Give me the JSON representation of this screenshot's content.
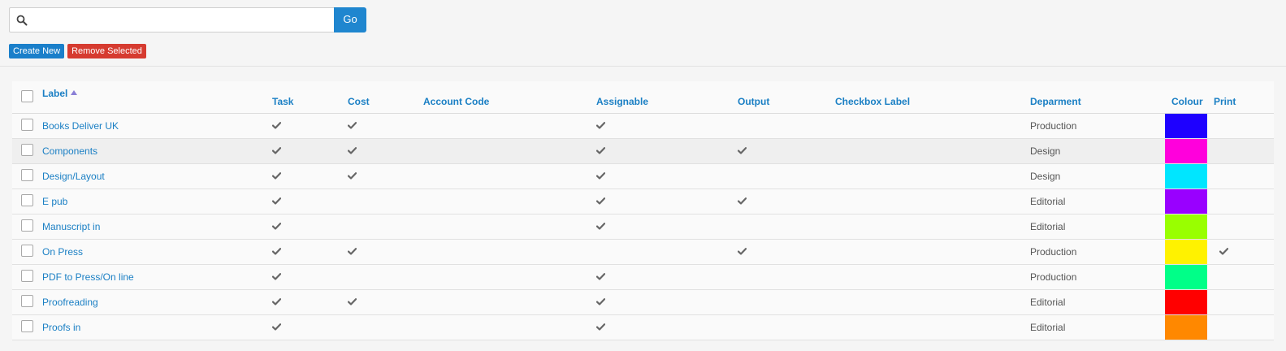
{
  "search": {
    "placeholder": "",
    "value": "",
    "go_label": "Go"
  },
  "actions": {
    "create_label": "Create New",
    "remove_label": "Remove Selected"
  },
  "table": {
    "columns": {
      "label": "Label",
      "task": "Task",
      "cost": "Cost",
      "account_code": "Account Code",
      "assignable": "Assignable",
      "output": "Output",
      "checkbox_label": "Checkbox Label",
      "department": "Deparment",
      "colour": "Colour",
      "print": "Print"
    },
    "sort": {
      "column": "label",
      "direction": "ascending"
    },
    "rows": [
      {
        "label": "Books Deliver UK",
        "task": true,
        "cost": true,
        "account_code": "",
        "assignable": true,
        "output": false,
        "checkbox_label": "",
        "department": "Production",
        "colour": "#1e00ff",
        "print": false
      },
      {
        "label": "Components",
        "task": true,
        "cost": true,
        "account_code": "",
        "assignable": true,
        "output": true,
        "checkbox_label": "",
        "department": "Design",
        "colour": "#ff00dc",
        "print": false
      },
      {
        "label": "Design/Layout",
        "task": true,
        "cost": true,
        "account_code": "",
        "assignable": true,
        "output": false,
        "checkbox_label": "",
        "department": "Design",
        "colour": "#00e6ff",
        "print": false
      },
      {
        "label": "E pub",
        "task": true,
        "cost": false,
        "account_code": "",
        "assignable": true,
        "output": true,
        "checkbox_label": "",
        "department": "Editorial",
        "colour": "#9900ff",
        "print": false
      },
      {
        "label": "Manuscript in",
        "task": true,
        "cost": false,
        "account_code": "",
        "assignable": true,
        "output": false,
        "checkbox_label": "",
        "department": "Editorial",
        "colour": "#99ff00",
        "print": false
      },
      {
        "label": "On Press",
        "task": true,
        "cost": true,
        "account_code": "",
        "assignable": false,
        "output": true,
        "checkbox_label": "",
        "department": "Production",
        "colour": "#fff200",
        "print": true
      },
      {
        "label": "PDF to Press/On line",
        "task": true,
        "cost": false,
        "account_code": "",
        "assignable": true,
        "output": false,
        "checkbox_label": "",
        "department": "Production",
        "colour": "#00ff88",
        "print": false
      },
      {
        "label": "Proofreading",
        "task": true,
        "cost": true,
        "account_code": "",
        "assignable": true,
        "output": false,
        "checkbox_label": "",
        "department": "Editorial",
        "colour": "#ff0000",
        "print": false
      },
      {
        "label": "Proofs in",
        "task": true,
        "cost": false,
        "account_code": "",
        "assignable": true,
        "output": false,
        "checkbox_label": "",
        "department": "Editorial",
        "colour": "#ff8800",
        "print": false
      }
    ]
  },
  "colors": {
    "accent": "#1a7fc4",
    "go_button": "#1f86cf",
    "remove_button": "#d63b30",
    "check": "#666666"
  },
  "icons": {
    "search": "search-icon",
    "check": "check-icon",
    "sort": "sort-ascending-icon"
  }
}
